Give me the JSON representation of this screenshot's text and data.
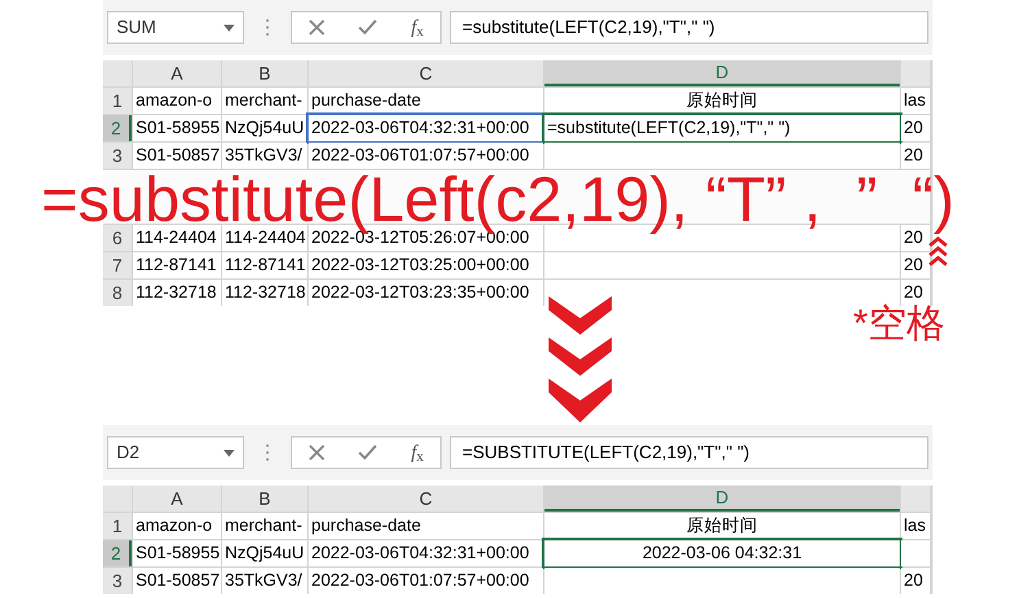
{
  "top_sheet": {
    "editing": true,
    "name_box": "SUM",
    "fx_label": "*f*$_{x}$",
    "formula": "=substitute(LEFT(C2,19),\"T\",\" \")",
    "columns": [
      {
        "label": "A",
        "selected": false,
        "referenced": false
      },
      {
        "label": "B",
        "selected": false,
        "referenced": false
      },
      {
        "label": "C",
        "selected": false,
        "referenced": true
      },
      {
        "label": "D",
        "selected": true,
        "referenced": false
      }
    ],
    "rows": [
      {
        "number": "1",
        "selected": false,
        "cells": [
          "amazon-o",
          "merchant-",
          "purchase-date",
          "原始时间",
          "las"
        ]
      },
      {
        "number": "2",
        "selected": true,
        "cells": [
          "S01-58955",
          "NzQj54uU",
          "2022-03-06T04:32:31+00:00",
          "=substitute(LEFT(C2,19),\"T\",\" \")",
          "20"
        ]
      },
      {
        "number": "3",
        "selected": false,
        "cells": [
          "S01-50857",
          "35TkGV3/",
          "2022-03-06T01:07:57+00:00",
          "",
          "20"
        ]
      },
      {
        "covered": true
      },
      {
        "number": "6",
        "selected": false,
        "cells": [
          "114-24404",
          "114-24404",
          "2022-03-12T05:26:07+00:00",
          "",
          "20"
        ]
      },
      {
        "number": "7",
        "selected": false,
        "cells": [
          "112-87141",
          "112-87141",
          "2022-03-12T03:25:00+00:00",
          "",
          "20"
        ]
      },
      {
        "number": "8",
        "selected": false,
        "cells": [
          "112-32718",
          "112-32718",
          "2022-03-12T03:23:35+00:00",
          "",
          "20"
        ]
      }
    ]
  },
  "callout": {
    "formula": "=substitute(Left(c2,19), “T” ,  ”  “)",
    "note": "*空格"
  },
  "bottom_sheet": {
    "name_box": "D2",
    "fx_label": "*f*$_{x}$",
    "formula": "=SUBSTITUTE(LEFT(C2,19),\"T\",\" \")",
    "columns": [
      {
        "label": "A",
        "selected": false,
        "referenced": false
      },
      {
        "label": "B",
        "selected": false,
        "referenced": false
      },
      {
        "label": "C",
        "selected": false,
        "referenced": false
      },
      {
        "label": "D",
        "selected": true,
        "referenced": false
      }
    ],
    "rows": [
      {
        "number": "1",
        "selected": false,
        "cells": [
          "amazon-o",
          "merchant-",
          "purchase-date",
          "原始时间",
          "las"
        ]
      },
      {
        "number": "2",
        "selected": true,
        "cells": [
          "S01-58955",
          "NzQj54uU",
          "2022-03-06T04:32:31+00:00",
          "2022-03-06 04:32:31",
          ""
        ]
      },
      {
        "number": "3",
        "selected": false,
        "cells": [
          "S01-50857",
          "35TkGV3/",
          "2022-03-06T01:07:57+00:00",
          "",
          "20"
        ]
      }
    ]
  }
}
